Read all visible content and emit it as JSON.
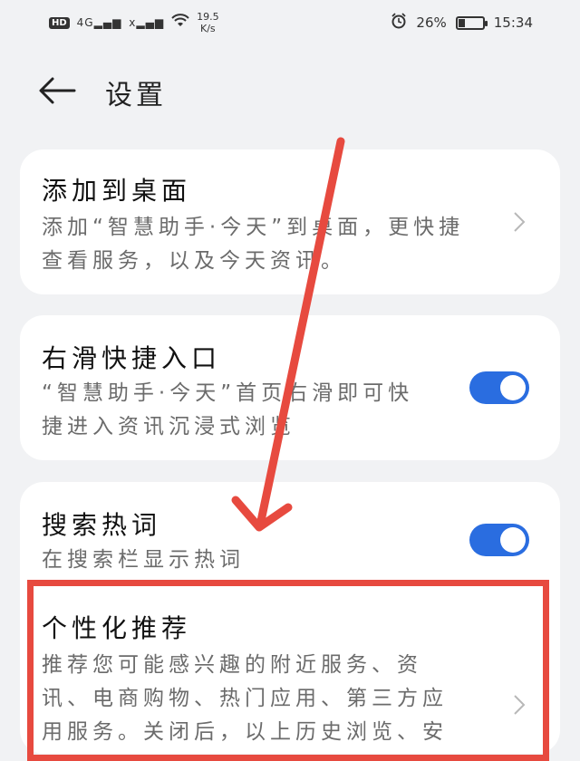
{
  "status_bar": {
    "network_badge": "HD",
    "signal1": "4G",
    "signal2": "x",
    "speed_value": "19.5",
    "speed_unit": "K/s",
    "battery_percent": "26%",
    "battery_level": 0.26,
    "time": "15:34"
  },
  "header": {
    "title": "设置"
  },
  "settings": [
    {
      "title": "添加到桌面",
      "desc_lines": [
        "添加“智慧助手·今天”到桌面，更快捷",
        "查看服务，以及今天资讯。"
      ],
      "control": "chevron"
    },
    {
      "title": "右滑快捷入口",
      "desc_lines": [
        "“智慧助手·今天”首页右滑即可快",
        "捷进入资讯沉浸式浏览"
      ],
      "control": "toggle",
      "enabled": true
    },
    {
      "title": "搜索热词",
      "desc_lines": [
        "在搜索栏显示热词"
      ],
      "control": "toggle",
      "enabled": true
    },
    {
      "title": "个性化推荐",
      "desc_lines": [
        "推荐您可能感兴趣的附近服务、资",
        "讯、电商购物、热门应用、第三方应",
        "用服务。关闭后，以上历史浏览、安"
      ],
      "control": "chevron"
    }
  ],
  "colors": {
    "toggle_on": "#2a6de0",
    "annotation": "#e74a3f"
  }
}
